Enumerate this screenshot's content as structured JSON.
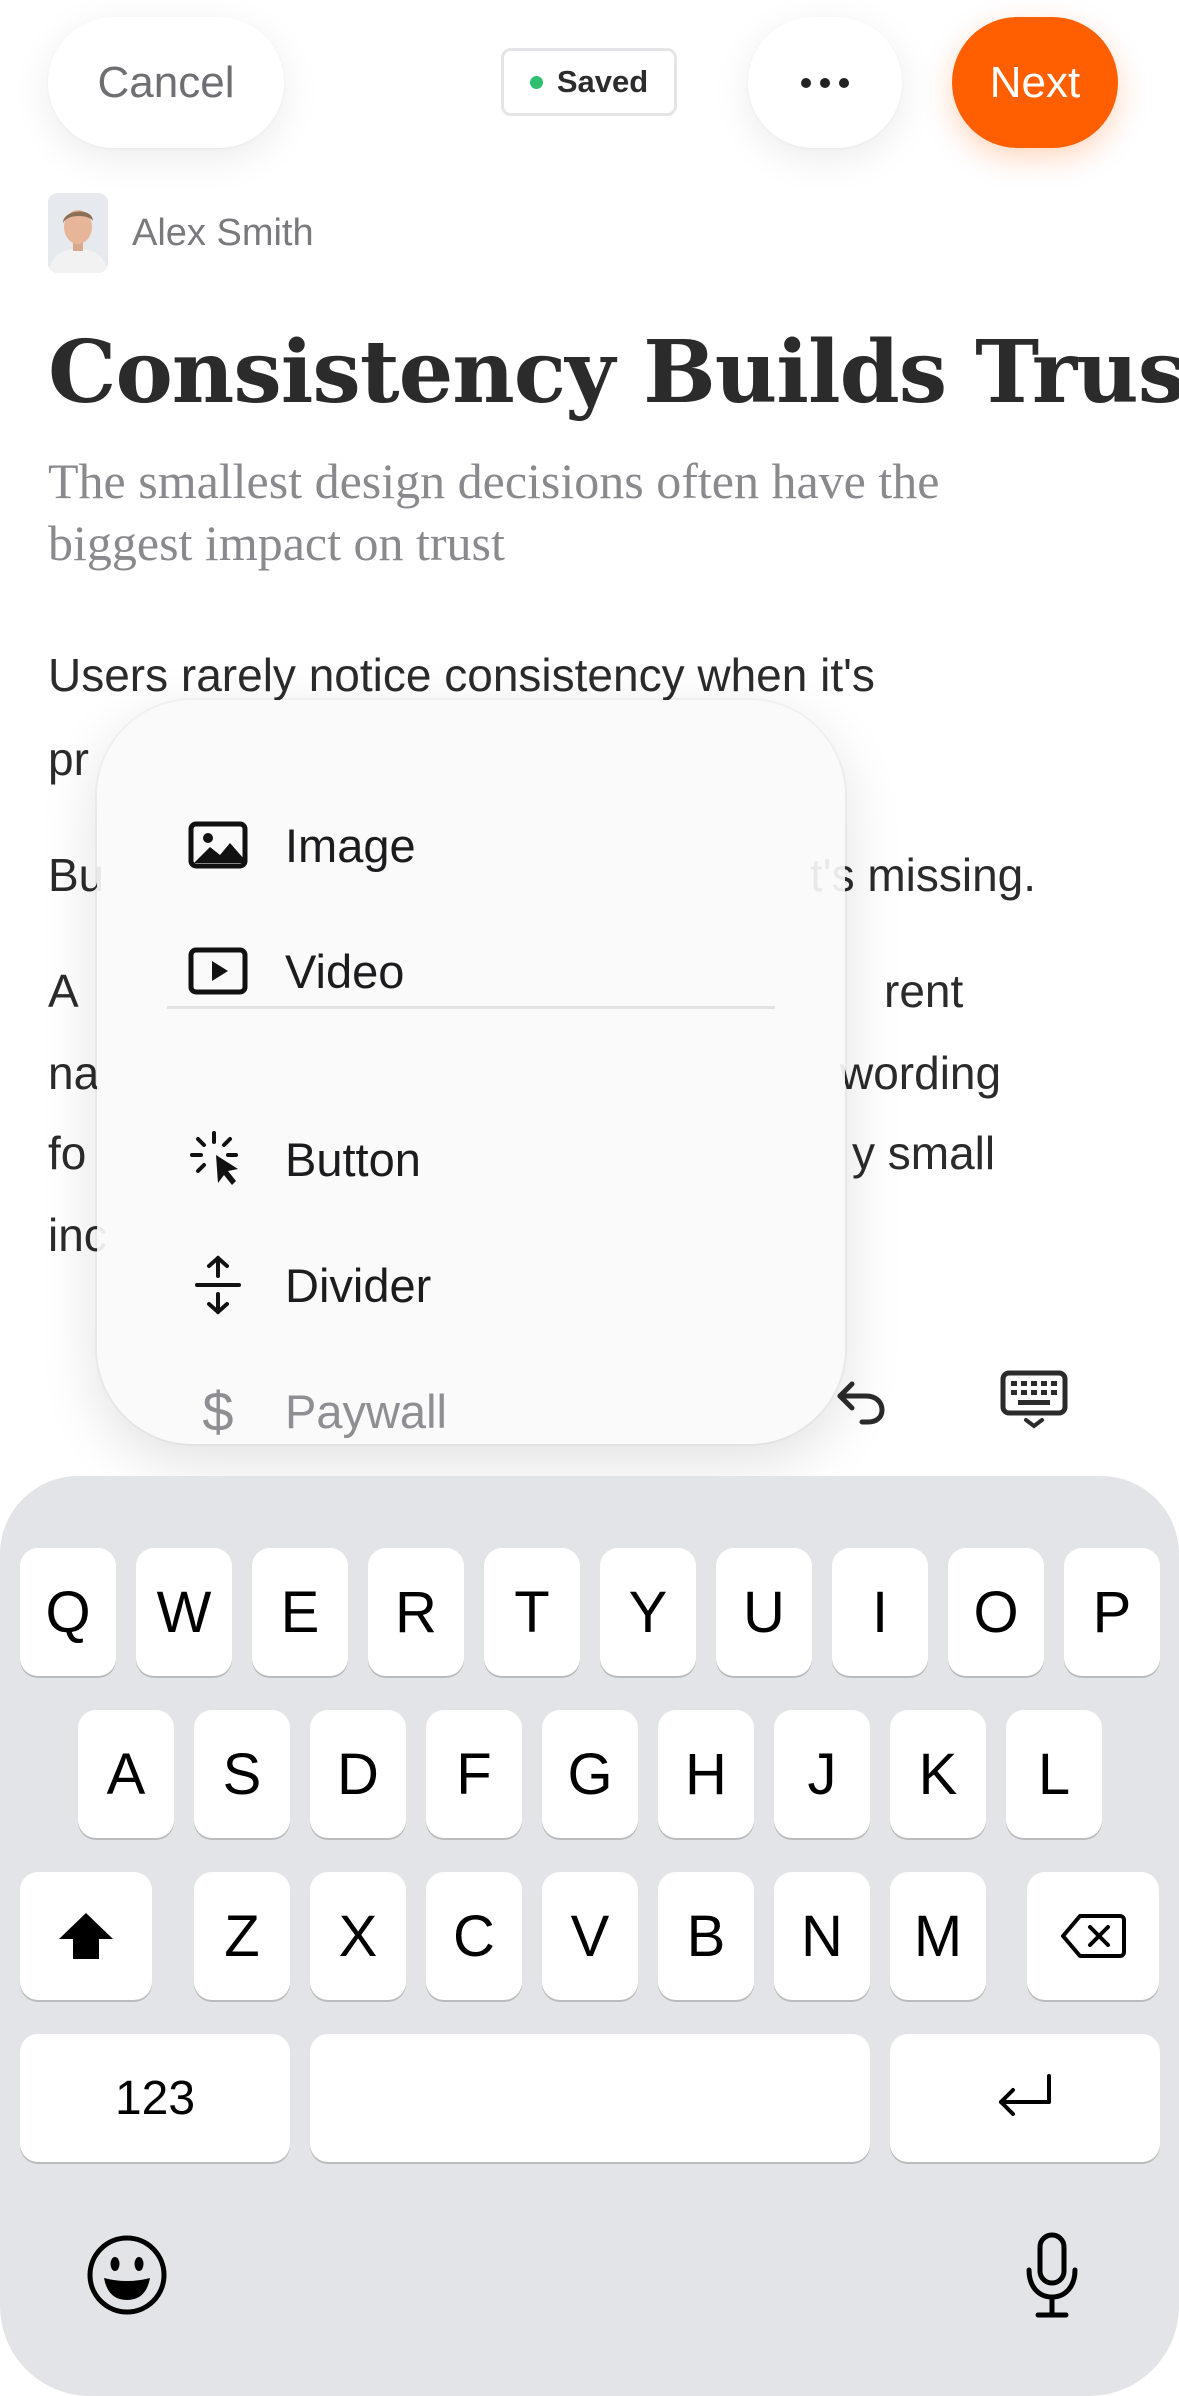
{
  "topbar": {
    "cancel_label": "Cancel",
    "saved_label": "Saved",
    "next_label": "Next",
    "accent": "#ff5f00",
    "saved_dot_color": "#2fbf71"
  },
  "author": {
    "name": "Alex Smith"
  },
  "article": {
    "title": "Consistency Builds Trust",
    "subtitle_line1": "The smallest design decisions often have the",
    "subtitle_line2": "biggest impact on trust",
    "body_lines": [
      "Users rarely notice consistency when it's",
      "pr",
      "Bu",
      "t's missing.",
      "A",
      "rent",
      "na",
      "wording",
      "fo",
      "y small",
      "inc"
    ]
  },
  "insert_menu": {
    "items": [
      {
        "label": "Image",
        "icon": "image-icon"
      },
      {
        "label": "Video",
        "icon": "video-icon"
      },
      {
        "label": "Button",
        "icon": "button-click-icon"
      },
      {
        "label": "Divider",
        "icon": "divider-icon"
      },
      {
        "label": "Paywall",
        "icon": "dollar-icon"
      }
    ]
  },
  "keyboard": {
    "row1": [
      "Q",
      "W",
      "E",
      "R",
      "T",
      "Y",
      "U",
      "I",
      "O",
      "P"
    ],
    "row2": [
      "A",
      "S",
      "D",
      "F",
      "G",
      "H",
      "J",
      "K",
      "L"
    ],
    "row3": [
      "Z",
      "X",
      "C",
      "V",
      "B",
      "N",
      "M"
    ],
    "numbers_label": "123"
  }
}
